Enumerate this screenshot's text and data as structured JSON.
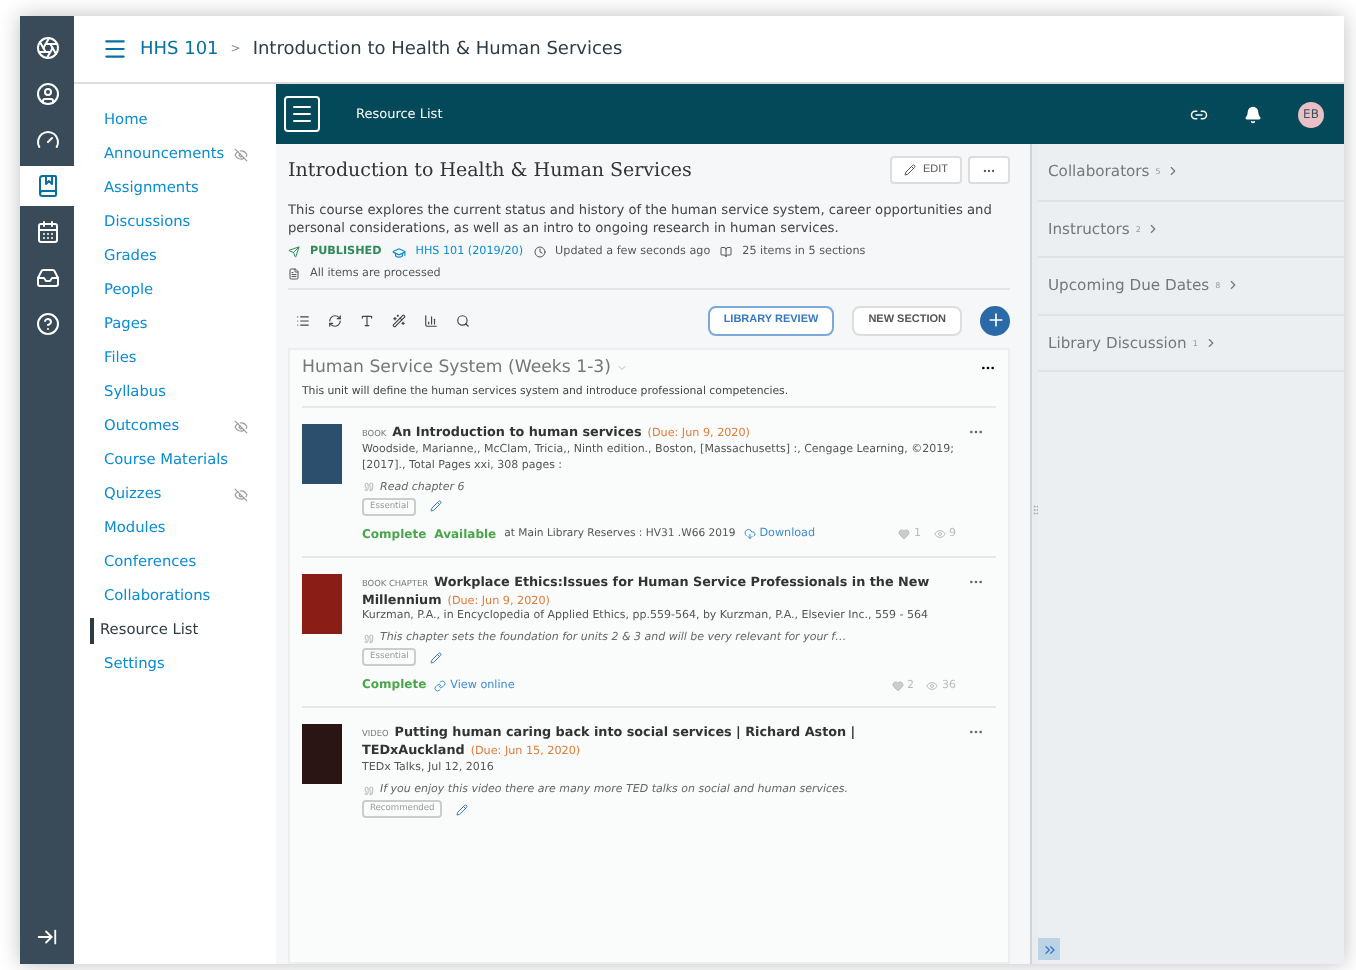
{
  "global_nav": [
    {
      "kind": "logo",
      "selected": false
    },
    {
      "kind": "account",
      "selected": false
    },
    {
      "kind": "dashboard",
      "selected": false
    },
    {
      "kind": "courses",
      "selected": true
    },
    {
      "kind": "calendar",
      "selected": false
    },
    {
      "kind": "inbox",
      "selected": false
    },
    {
      "kind": "help",
      "selected": false
    }
  ],
  "breadcrumb": {
    "course": "HHS 101",
    "separator": ">",
    "page": "Introduction to Health & Human Services"
  },
  "course_nav": [
    {
      "label": "Home",
      "selected": false,
      "hidden": false
    },
    {
      "label": "Announcements",
      "selected": false,
      "hidden": true
    },
    {
      "label": "Assignments",
      "selected": false,
      "hidden": false
    },
    {
      "label": "Discussions",
      "selected": false,
      "hidden": false
    },
    {
      "label": "Grades",
      "selected": false,
      "hidden": false
    },
    {
      "label": "People",
      "selected": false,
      "hidden": false
    },
    {
      "label": "Pages",
      "selected": false,
      "hidden": false
    },
    {
      "label": "Files",
      "selected": false,
      "hidden": false
    },
    {
      "label": "Syllabus",
      "selected": false,
      "hidden": false
    },
    {
      "label": "Outcomes",
      "selected": false,
      "hidden": true
    },
    {
      "label": "Course Materials",
      "selected": false,
      "hidden": false
    },
    {
      "label": "Quizzes",
      "selected": false,
      "hidden": true
    },
    {
      "label": "Modules",
      "selected": false,
      "hidden": false
    },
    {
      "label": "Conferences",
      "selected": false,
      "hidden": false
    },
    {
      "label": "Collaborations",
      "selected": false,
      "hidden": false
    },
    {
      "label": "Resource List",
      "selected": true,
      "hidden": false
    },
    {
      "label": "Settings",
      "selected": false,
      "hidden": false
    }
  ],
  "app_bar": {
    "title": "Resource List",
    "avatar": "EB"
  },
  "list": {
    "title": "Introduction to Health & Human Services",
    "edit": "EDIT",
    "description": "This course explores the current status and history of the human service system, career opportunities and personal considerations, as well as an intro to ongoing research in human services.",
    "status": "PUBLISHED",
    "course_code": "HHS 101 (2019/20)",
    "updated": "Updated a few seconds ago",
    "count": "25 items in 5 sections",
    "processed": "All items are processed",
    "library_review": "LIBRARY REVIEW",
    "new_section": "NEW SECTION"
  },
  "section": {
    "title": "Human Service System (Weeks 1-3)",
    "description": "This unit will define the human services system and introduce professional competencies.",
    "items": [
      {
        "kind": "book",
        "type": "BOOK",
        "title": "An Introduction to human services",
        "due": "(Due:  Jun 9, 2020)",
        "details": "Woodside, Marianne,, McClam, Tricia,, Ninth edition., Boston, [Massachusetts] :, Cengage Learning, ©2019; [2017]., Total Pages xxi, 308 pages :",
        "note": "Read chapter 6",
        "tag": "Essential",
        "status": "Complete",
        "availability": "Available",
        "location": "at Main Library Reserves : HV31 .W66 2019",
        "action": "Download",
        "likes": "1",
        "views": "9"
      },
      {
        "kind": "chapter",
        "type": "BOOK CHAPTER",
        "title": "Workplace Ethics:Issues for Human Service Professionals in the New Millennium",
        "due": "(Due:  Jun 9, 2020)",
        "details": "Kurzman, P.A., in Encyclopedia of Applied Ethics, pp.559-564, by Kurzman, P.A., Elsevier Inc., 559 - 564",
        "note": "This chapter sets the foundation for units 2 & 3 and will be very relevant for your f…",
        "tag": "Essential",
        "status": "Complete",
        "action": "View online",
        "likes": "2",
        "views": "36"
      },
      {
        "kind": "video",
        "type": "VIDEO",
        "title": "Putting human caring back into social services | Richard Aston | TEDxAuckland",
        "due": "(Due:  Jun 15, 2020)",
        "details": "TEDx Talks, Jul 12, 2016",
        "note": "If you enjoy this video there are many more TED talks on social and human services.",
        "tag": "Recommended"
      }
    ]
  },
  "side_panel": [
    {
      "label": "Collaborators",
      "count": "5"
    },
    {
      "label": "Instructors",
      "count": "2"
    },
    {
      "label": "Upcoming Due Dates",
      "count": "8"
    },
    {
      "label": "Library Discussion",
      "count": "1"
    }
  ]
}
